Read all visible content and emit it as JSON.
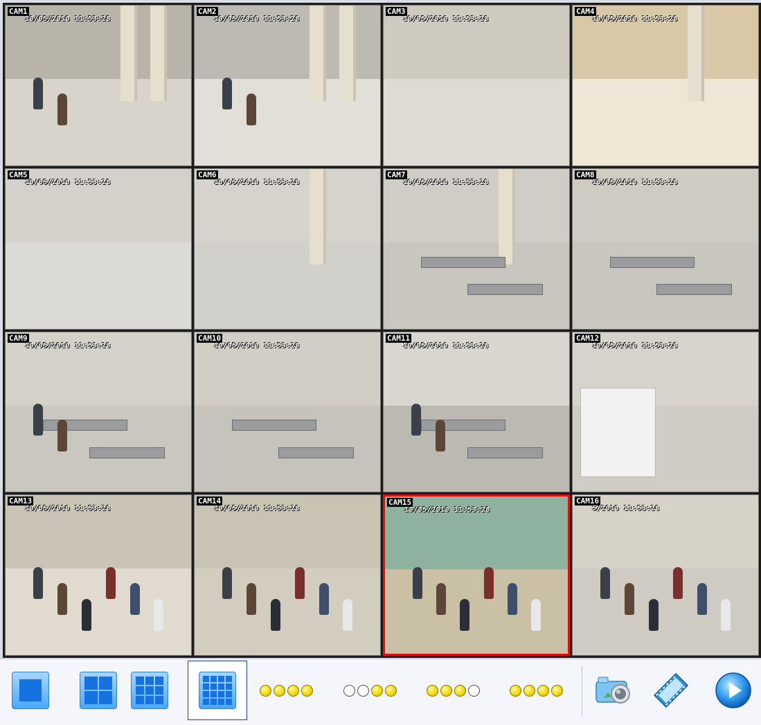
{
  "cameras": [
    {
      "label": "CAM1",
      "timestamp": "10/05/2010 11:53:28"
    },
    {
      "label": "CAM2",
      "timestamp": "10/05/2010 11:53:28"
    },
    {
      "label": "CAM3",
      "timestamp": "10/05/2010 11:53:28"
    },
    {
      "label": "CAM4",
      "timestamp": "10/05/2010 11:53:28"
    },
    {
      "label": "CAM5",
      "timestamp": "10/05/2010 11:53:28"
    },
    {
      "label": "CAM6",
      "timestamp": "10/05/2010 11:53:28"
    },
    {
      "label": "CAM7",
      "timestamp": "10/05/2010 11:53:28"
    },
    {
      "label": "CAM8",
      "timestamp": "10/05/2010 11:53:28"
    },
    {
      "label": "CAM9",
      "timestamp": "10/05/2010 11:53:28"
    },
    {
      "label": "CAM10",
      "timestamp": "10/05/2010 11:53:28"
    },
    {
      "label": "CAM11",
      "timestamp": "10/05/2010 11:53:28"
    },
    {
      "label": "CAM12",
      "timestamp": "10/05/2010 11:53:28"
    },
    {
      "label": "CAM13",
      "timestamp": "10/05/2010 11:53:28"
    },
    {
      "label": "CAM14",
      "timestamp": "10/05/2010 11:53:28"
    },
    {
      "label": "CAM15",
      "timestamp": "10/05/2010 11:53:28"
    },
    {
      "label": "CAM16",
      "timestamp": "5/2010 11:53:28"
    }
  ],
  "active_camera": "CAM15",
  "layout_buttons": [
    {
      "name": "layout-1x1",
      "icon": "single-view-icon",
      "selected": false
    },
    {
      "name": "layout-2x2",
      "icon": "quad-view-icon",
      "selected": false
    },
    {
      "name": "layout-3x3",
      "icon": "nine-view-icon",
      "selected": false
    },
    {
      "name": "layout-4x4",
      "icon": "sixteen-view-icon",
      "selected": true
    }
  ],
  "channel_groups": [
    [
      true,
      true,
      true,
      true
    ],
    [
      false,
      false,
      true,
      true
    ],
    [
      true,
      true,
      true,
      false
    ],
    [
      true,
      true,
      true,
      true
    ]
  ],
  "tools": [
    {
      "name": "snapshot-button",
      "icon": "camera-icon"
    },
    {
      "name": "record-button",
      "icon": "film-icon"
    },
    {
      "name": "play-button",
      "icon": "play-icon"
    }
  ],
  "colors": {
    "accent": "#1572e0",
    "active_border": "#e01010",
    "dot_on": "#f0d800"
  }
}
